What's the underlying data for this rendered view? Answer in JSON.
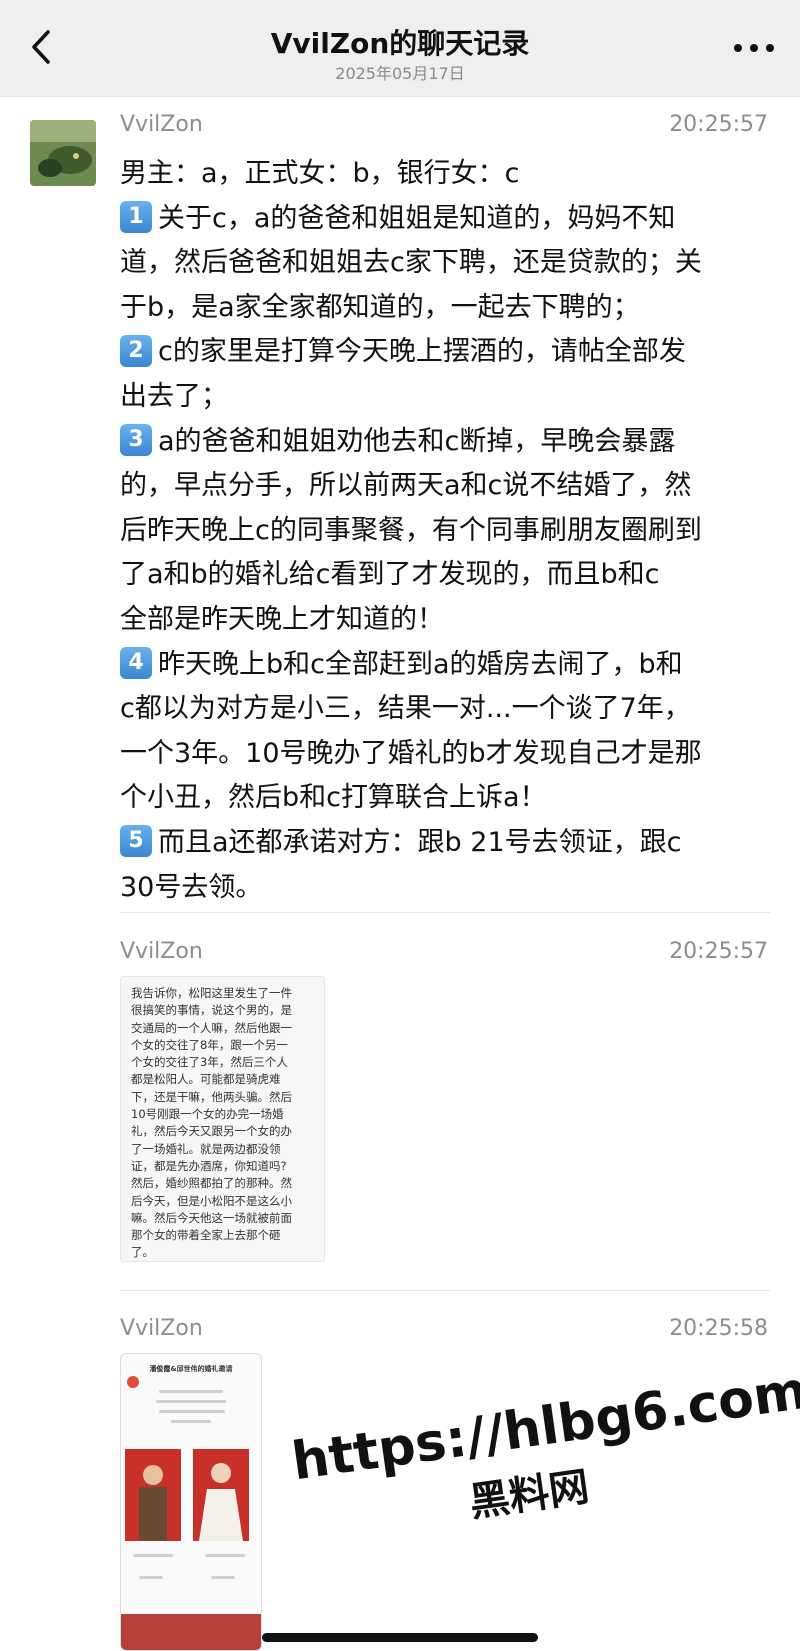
{
  "header": {
    "title": "VvilZon的聊天记录",
    "date": "2025年05月17日",
    "back_icon": "chevron-left-icon",
    "more_icon": "more-dots-icon"
  },
  "messages": [
    {
      "sender": "VvilZon",
      "time": "20:25:57",
      "lines": [
        {
          "num": "",
          "text": "男主：a，正式女：b，银行女：c"
        },
        {
          "num": "1",
          "text": "关于c，a的爸爸和姐姐是知道的，妈妈不知"
        },
        {
          "num": "",
          "text": "道，然后爸爸和姐姐去c家下聘，还是贷款的；关"
        },
        {
          "num": "",
          "text": "于b，是a家全家都知道的，一起去下聘的；"
        },
        {
          "num": "2",
          "text": "c的家里是打算今天晚上摆酒的，请帖全部发"
        },
        {
          "num": "",
          "text": "出去了；"
        },
        {
          "num": "3",
          "text": "a的爸爸和姐姐劝他去和c断掉，早晚会暴露"
        },
        {
          "num": "",
          "text": "的，早点分手，所以前两天a和c说不结婚了，然"
        },
        {
          "num": "",
          "text": "后昨天晚上c的同事聚餐，有个同事刷朋友圈刷到"
        },
        {
          "num": "",
          "text": "了a和b的婚礼给c看到了才发现的，而且b和c"
        },
        {
          "num": "",
          "text": "全部是昨天晚上才知道的！"
        },
        {
          "num": "4",
          "text": "昨天晚上b和c全部赶到a的婚房去闹了，b和"
        },
        {
          "num": "",
          "text": "c都以为对方是小三，结果一对...一个谈了7年，"
        },
        {
          "num": "",
          "text": "一个3年。10号晚办了婚礼的b才发现自己才是那"
        },
        {
          "num": "",
          "text": "个小丑，然后b和c打算联合上诉a！"
        },
        {
          "num": "5",
          "text": "而且a还都承诺对方：跟b 21号去领证，跟c"
        },
        {
          "num": "",
          "text": "30号去领。"
        }
      ]
    },
    {
      "sender": "VvilZon",
      "time": "20:25:57",
      "note_lines": [
        "我告诉你，松阳这里发生了一件",
        "很搞笑的事情，说这个男的，是",
        "交通局的一个人嘛，然后他跟一",
        "个女的交往了8年，跟一个另一",
        "个女的交往了3年，然后三个人",
        "都是松阳人。可能都是骑虎难",
        "下，还是干嘛，他两头骗。然后",
        "10号刚跟一个女的办完一场婚",
        "礼，然后今天又跟另一个女的办",
        "了一场婚礼。就是两边都没领",
        "证，都是先办酒席，你知道吗?",
        "然后，婚纱照都拍了的那种。然",
        "后今天，但是小松阳不是这么小",
        "嘛。然后今天他这一场就被前面",
        "那个女的带着全家上去那个砸",
        "了。"
      ]
    },
    {
      "sender": "VvilZon",
      "time": "20:25:58",
      "image_title": "潘俊霞&邱世伟的婚礼邀请"
    }
  ],
  "watermark": {
    "url": "https://hlbg6.com",
    "name": "黑料网"
  }
}
